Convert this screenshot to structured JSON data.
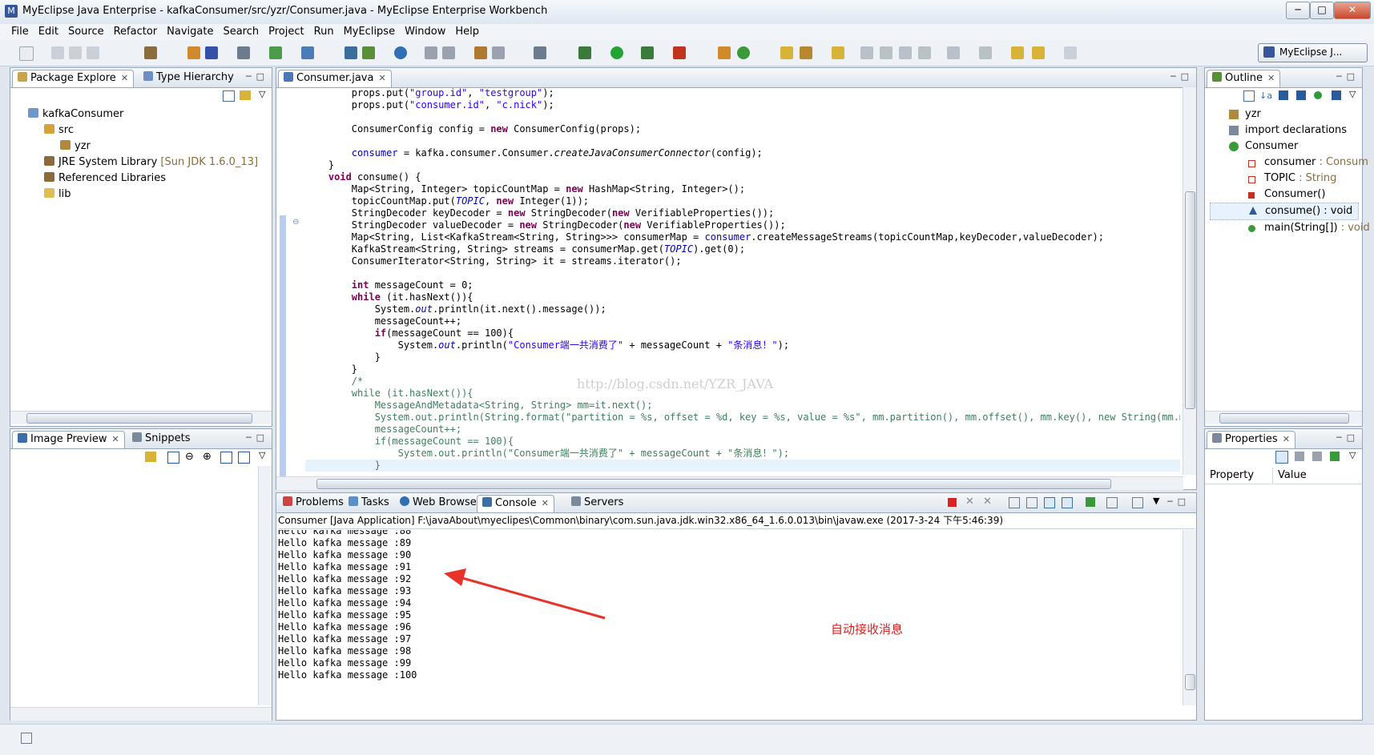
{
  "window": {
    "title": "MyEclipse Java Enterprise - kafkaConsumer/src/yzr/Consumer.java - MyEclipse Enterprise Workbench"
  },
  "menu": [
    "File",
    "Edit",
    "Source",
    "Refactor",
    "Navigate",
    "Search",
    "Project",
    "Run",
    "MyEclipse",
    "Window",
    "Help"
  ],
  "perspective": {
    "label": "MyEclipse J..."
  },
  "package_explorer": {
    "tabs": [
      "Package Explore",
      "Type Hierarchy"
    ],
    "tree": {
      "project": "kafkaConsumer",
      "src": "src",
      "package": "yzr",
      "jre": "JRE System Library",
      "jre_version": "[Sun JDK 1.6.0_13]",
      "referenced": "Referenced Libraries",
      "lib": "lib"
    }
  },
  "image_preview": {
    "tabs": [
      "Image Preview",
      "Snippets"
    ]
  },
  "editor": {
    "tab": "Consumer.java",
    "watermark": "http://blog.csdn.net/YZR_JAVA"
  },
  "bottom": {
    "tabs": [
      "Problems",
      "Tasks",
      "Web Browser",
      "Console",
      "Servers"
    ],
    "console_header": "Consumer [Java Application] F:\\javaAbout\\myeclipes\\Common\\binary\\com.sun.java.jdk.win32.x86_64_1.6.0.013\\bin\\javaw.exe (2017-3-24 下午5:46:39)",
    "lines": [
      "Hello kafka message :88",
      "Hello kafka message :89",
      "Hello kafka message :90",
      "Hello kafka message :91",
      "Hello kafka message :92",
      "Hello kafka message :93",
      "Hello kafka message :94",
      "Hello kafka message :95",
      "Hello kafka message :96",
      "Hello kafka message :97",
      "Hello kafka message :98",
      "Hello kafka message :99",
      "Hello kafka message :100"
    ],
    "annotation": "自动接收消息"
  },
  "outline": {
    "tab": "Outline",
    "items": {
      "pkg": "yzr",
      "imports": "import declarations",
      "cls": "Consumer",
      "f1_name": "consumer",
      "f1_type": " : Consum",
      "f2_name": "TOPIC",
      "f2_type": " : String",
      "ctor": "Consumer()",
      "m1": "consume() : void",
      "m2_name": "main(String[])",
      "m2_type": " : void"
    }
  },
  "properties": {
    "tab": "Properties",
    "col_property": "Property",
    "col_value": "Value"
  }
}
